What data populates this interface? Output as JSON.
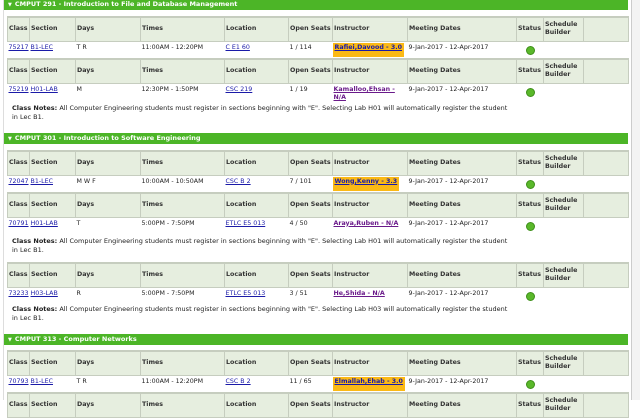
{
  "headers": [
    "Class",
    "Section",
    "Days",
    "Times",
    "Location",
    "Open Seats",
    "Instructor",
    "Meeting Dates",
    "Status",
    "Schedule Builder",
    ""
  ],
  "notes_label": "Class Notes:",
  "courses": [
    {
      "title": "CMPUT 291 - Introduction to File and Database Management",
      "sections": [
        {
          "class": "75217",
          "section": "B1-LEC",
          "days": "T R",
          "times": "11:00AM - 12:20PM",
          "location": "C E1 60",
          "seats": "1 / 114",
          "instructor": "Rafiei,Davood - 3.0",
          "highlight": true,
          "dates": "9-Jan-2017 - 12-Apr-2017",
          "status": "open"
        },
        {
          "class": "75219",
          "section": "H01-LAB",
          "days": "M",
          "times": "12:30PM - 1:50PM",
          "location": "CSC 219",
          "seats": "1 / 19",
          "instructor": "Kamalloo,Ehsan - N/A",
          "highlight": false,
          "dates": "9-Jan-2017 - 12-Apr-2017",
          "status": "open",
          "notes": "All Computer Engineering students must register in sections beginning with \"E\". Selecting Lab H01 will automatically register the student in Lec B1."
        }
      ]
    },
    {
      "title": "CMPUT 301 - Introduction to Software Engineering",
      "sections": [
        {
          "class": "72047",
          "section": "B1-LEC",
          "days": "M W F",
          "times": "10:00AM - 10:50AM",
          "location": "CSC B 2",
          "seats": "7 / 101",
          "instructor": "Wong,Kenny - 3.3",
          "highlight": true,
          "dates": "9-Jan-2017 - 12-Apr-2017",
          "status": "open"
        },
        {
          "class": "70791",
          "section": "H01-LAB",
          "days": "T",
          "times": "5:00PM - 7:50PM",
          "location": "ETLC E5 013",
          "seats": "4 / 50",
          "instructor": "Araya,Ruben - N/A",
          "highlight": false,
          "dates": "9-Jan-2017 - 12-Apr-2017",
          "status": "open",
          "notes": "All Computer Engineering students must register in sections beginning with \"E\". Selecting Lab H01 will automatically register the student in Lec B1."
        },
        {
          "class": "73233",
          "section": "H03-LAB",
          "days": "R",
          "times": "5:00PM - 7:50PM",
          "location": "ETLC E5 013",
          "seats": "3 / 51",
          "instructor": "He,Shida - N/A",
          "highlight": false,
          "dates": "9-Jan-2017 - 12-Apr-2017",
          "status": "open",
          "notes": "All Computer Engineering students must register in sections beginning with \"E\". Selecting Lab H03 will automatically register the student in Lec B1."
        }
      ]
    },
    {
      "title": "CMPUT 313 - Computer Networks",
      "sections": [
        {
          "class": "70793",
          "section": "B1-LEC",
          "days": "T R",
          "times": "11:00AM - 12:20PM",
          "location": "CSC B 2",
          "seats": "11 / 65",
          "instructor": "Elmallah,Ehab - 3.0",
          "highlight": true,
          "dates": "9-Jan-2017 - 12-Apr-2017",
          "status": "open"
        },
        {
          "partial": true
        }
      ]
    }
  ],
  "colors": {
    "bar": "#4cb527",
    "highlight": "#fbb915",
    "status_open": "#5ab82a"
  }
}
